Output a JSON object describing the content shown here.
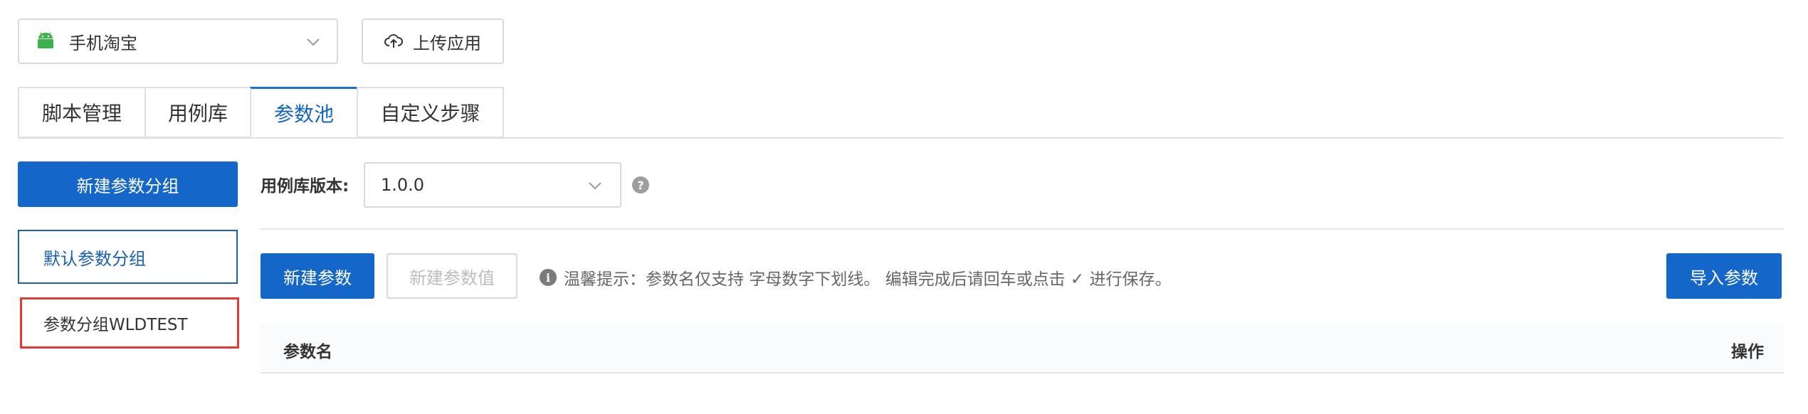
{
  "app_selector": {
    "value": "手机淘宝",
    "icon": "android-icon",
    "accent": "#3ddc84"
  },
  "upload_button": {
    "label": "上传应用",
    "icon": "cloud-upload-icon"
  },
  "tabs": [
    {
      "label": "脚本管理",
      "active": false
    },
    {
      "label": "用例库",
      "active": false
    },
    {
      "label": "参数池",
      "active": true
    },
    {
      "label": "自定义步骤",
      "active": false
    }
  ],
  "sidebar": {
    "new_group_label": "新建参数分组",
    "groups": [
      {
        "label": "默认参数分组",
        "selected": true
      },
      {
        "label": "参数分组WLDTEST",
        "selected": false
      }
    ]
  },
  "version": {
    "label": "用例库版本:",
    "value": "1.0.0",
    "help": "?"
  },
  "toolbar": {
    "new_param_label": "新建参数",
    "new_value_label": "新建参数值",
    "tip_icon": "i",
    "tip_text": "温馨提示：参数名仅支持 字母数字下划线。 编辑完成后请回车或点击 ✓ 进行保存。",
    "import_label": "导入参数"
  },
  "table": {
    "columns": [
      "参数名",
      "操作"
    ]
  },
  "colors": {
    "primary": "#1467c8",
    "highlight_border": "#e53935"
  }
}
